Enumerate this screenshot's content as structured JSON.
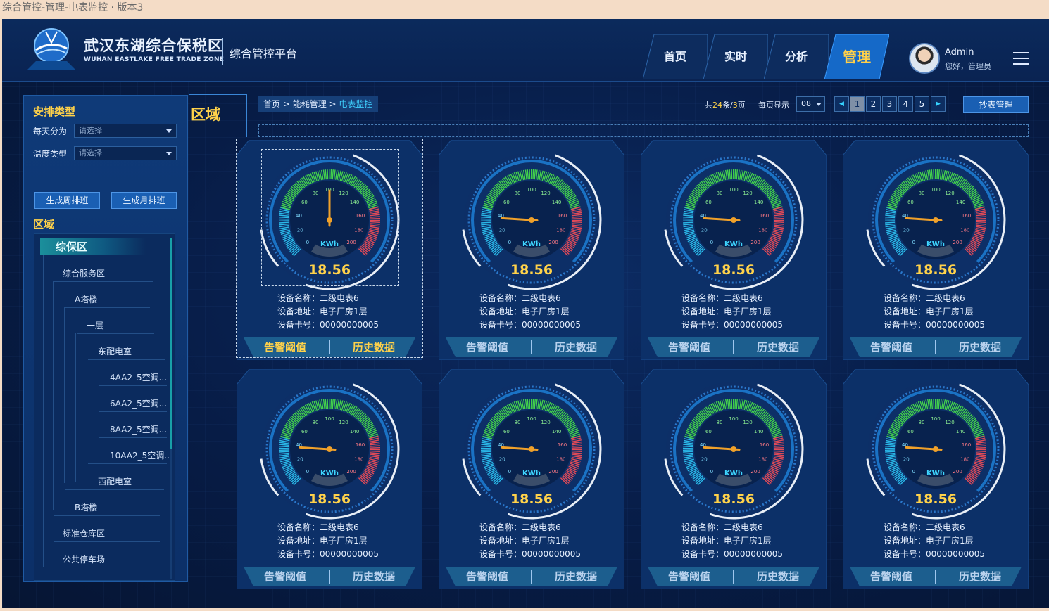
{
  "doc_title": "综合管控-管理-电表监控 · 版本3",
  "brand": {
    "name_cn": "武汉东湖综合保税区",
    "name_en": "WUHAN EASTLAKE FREE TRADE ZONE",
    "platform": "综合管控平台"
  },
  "nav": [
    {
      "label": "首页"
    },
    {
      "label": "实时"
    },
    {
      "label": "分析"
    },
    {
      "label": "管理",
      "active": true
    }
  ],
  "user": {
    "name": "Admin",
    "greeting": "您好，管理员"
  },
  "sidebar": {
    "schedule_title": "安排类型",
    "daily_label": "每天分为",
    "daily_placeholder": "请选择",
    "temp_label": "温度类型",
    "temp_placeholder": "请选择",
    "btn_week": "生成周排班",
    "btn_month": "生成月排班",
    "region_title": "区域",
    "tree_root": "综保区",
    "tree": [
      "综合服务区",
      "A塔楼",
      "一层",
      "东配电室",
      "4AA2_5空调...",
      "6AA2_5空调...",
      "8AA2_5空调...",
      "10AA2_5空调...",
      "西配电室",
      "B塔楼",
      "标准仓库区",
      "公共停车场"
    ]
  },
  "region_tag": "区域",
  "breadcrumb": {
    "home": "首页",
    "sep": " > ",
    "parent": "能耗管理",
    "current": "电表监控"
  },
  "pager": {
    "total_prefix": "共",
    "total": "24",
    "total_mid": "条/",
    "pages": "3",
    "total_suffix": "页",
    "per_label": "每页显示",
    "per_value": "08",
    "pages_list": [
      "1",
      "2",
      "3",
      "4",
      "5"
    ],
    "current": "1"
  },
  "read_btn": "抄表管理",
  "gauge": {
    "unit": "KWh",
    "ticks": [
      "0",
      "20",
      "40",
      "60",
      "80",
      "100",
      "120",
      "140",
      "160",
      "180",
      "200"
    ],
    "min": 0,
    "max": 200
  },
  "cards": [
    {
      "value": "18.56",
      "needle": 100,
      "name_label": "设备名称：",
      "name": "二级电表6",
      "addr_label": "设备地址：",
      "addr": "电子厂房1层",
      "card_label": "设备卡号：",
      "card_no": "00000000005",
      "btn_alarm": "告警阈值",
      "btn_history": "历史数据"
    },
    {
      "value": "18.56",
      "needle": 36,
      "name_label": "设备名称：",
      "name": "二级电表6",
      "addr_label": "设备地址：",
      "addr": "电子厂房1层",
      "card_label": "设备卡号：",
      "card_no": "00000000005",
      "btn_alarm": "告警阈值",
      "btn_history": "历史数据"
    },
    {
      "value": "18.56",
      "needle": 36,
      "name_label": "设备名称：",
      "name": "二级电表6",
      "addr_label": "设备地址：",
      "addr": "电子厂房1层",
      "card_label": "设备卡号：",
      "card_no": "00000000005",
      "btn_alarm": "告警阈值",
      "btn_history": "历史数据"
    },
    {
      "value": "18.56",
      "needle": 36,
      "name_label": "设备名称：",
      "name": "二级电表6",
      "addr_label": "设备地址：",
      "addr": "电子厂房1层",
      "card_label": "设备卡号：",
      "card_no": "00000000005",
      "btn_alarm": "告警阈值",
      "btn_history": "历史数据"
    },
    {
      "value": "18.56",
      "needle": 36,
      "name_label": "设备名称：",
      "name": "二级电表6",
      "addr_label": "设备地址：",
      "addr": "电子厂房1层",
      "card_label": "设备卡号：",
      "card_no": "00000000005",
      "btn_alarm": "告警阈值",
      "btn_history": "历史数据"
    },
    {
      "value": "18.56",
      "needle": 36,
      "name_label": "设备名称：",
      "name": "二级电表6",
      "addr_label": "设备地址：",
      "addr": "电子厂房1层",
      "card_label": "设备卡号：",
      "card_no": "00000000005",
      "btn_alarm": "告警阈值",
      "btn_history": "历史数据"
    },
    {
      "value": "18.56",
      "needle": 36,
      "name_label": "设备名称：",
      "name": "二级电表6",
      "addr_label": "设备地址：",
      "addr": "电子厂房1层",
      "card_label": "设备卡号：",
      "card_no": "00000000005",
      "btn_alarm": "告警阈值",
      "btn_history": "历史数据"
    },
    {
      "value": "18.56",
      "needle": 36,
      "name_label": "设备名称：",
      "name": "二级电表6",
      "addr_label": "设备地址：",
      "addr": "电子厂房1层",
      "card_label": "设备卡号：",
      "card_no": "00000000005",
      "btn_alarm": "告警阈值",
      "btn_history": "历史数据"
    }
  ],
  "colors": {
    "accent": "#ffd24a",
    "cyan": "#35d3ff",
    "green": "#42d34a",
    "red": "#e24a57",
    "panel": "#0f3a78"
  }
}
